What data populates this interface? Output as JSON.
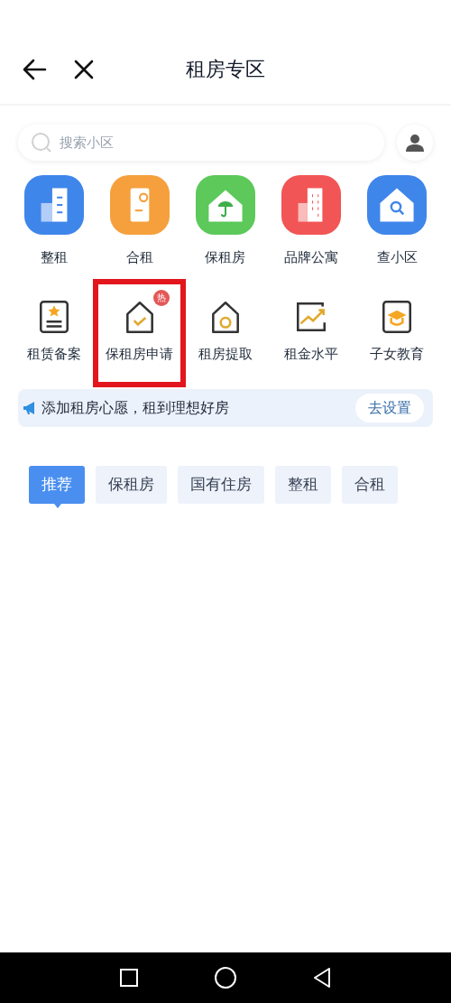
{
  "header": {
    "title": "租房专区"
  },
  "search": {
    "placeholder": "搜索小区"
  },
  "main_services": [
    {
      "label": "整租",
      "kind": "building",
      "color": "#3f86ea"
    },
    {
      "label": "合租",
      "kind": "door",
      "color": "#f5a03c"
    },
    {
      "label": "保租房",
      "kind": "umbrella",
      "color": "#5cc95a"
    },
    {
      "label": "品牌公寓",
      "kind": "tower",
      "color": "#f25555"
    },
    {
      "label": "查小区",
      "kind": "search-house",
      "color": "#3f86ea"
    }
  ],
  "sub_services": [
    {
      "label": "租赁备案",
      "kind": "document",
      "highlighted": false
    },
    {
      "label": "保租房申请",
      "kind": "house-check",
      "badge": "热",
      "highlighted": true
    },
    {
      "label": "租房提取",
      "kind": "house-bag",
      "highlighted": false
    },
    {
      "label": "租金水平",
      "kind": "trend",
      "highlighted": false
    },
    {
      "label": "子女教育",
      "kind": "graduation",
      "highlighted": false
    }
  ],
  "wish_banner": {
    "text": "添加租房心愿，租到理想好房",
    "button": "去设置"
  },
  "tabs": [
    {
      "label": "推荐",
      "selected": true
    },
    {
      "label": "保租房",
      "selected": false
    },
    {
      "label": "国有住房",
      "selected": false
    },
    {
      "label": "整租",
      "selected": false
    },
    {
      "label": "合租",
      "selected": false
    }
  ]
}
